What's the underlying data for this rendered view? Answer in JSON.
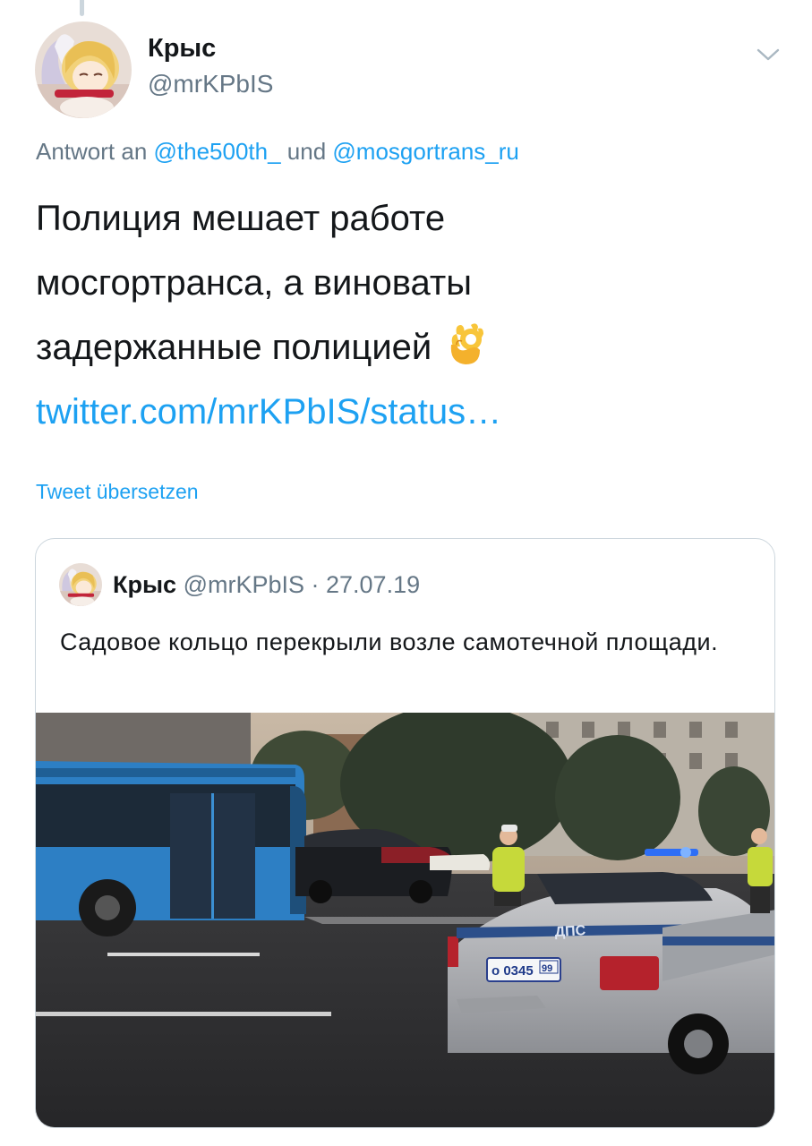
{
  "tweet": {
    "author_name": "Крыс",
    "author_handle": "@mrKPbIS",
    "reply_prefix": "Antwort an ",
    "reply_mention_1": "@the500th_",
    "reply_joiner": " und ",
    "reply_mention_2": "@mosgortrans_ru",
    "text_line_1": "Полиция мешает работе",
    "text_line_2": "мосгортранса, а виноваты",
    "text_line_3": "задержанные полицией",
    "link": "twitter.com/mrKPbIS/status…",
    "translate_label": "Tweet übersetzen"
  },
  "quoted": {
    "author_name": "Крыс",
    "author_handle": "@mrKPbIS",
    "separator": " · ",
    "date": "27.07.19",
    "text": "Садовое кольцо перекрыли возле самотечной площади.",
    "photo": {
      "plate_main": "о 0345",
      "plate_region": "99",
      "car_lettering": "ДПС"
    }
  },
  "icons": {
    "menu": "chevron-down-icon",
    "emoji": "ok-hand-emoji"
  },
  "colors": {
    "link": "#1da1f2",
    "secondary_text": "#657786",
    "primary_text": "#14171a",
    "border": "#ccd6dd"
  }
}
